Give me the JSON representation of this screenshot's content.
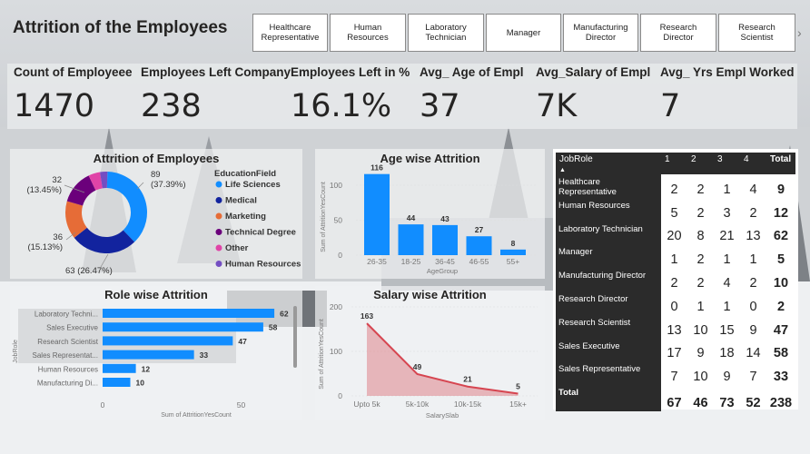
{
  "title": "Attrition of the Employees",
  "slicers": [
    "Healthcare Representative",
    "Human Resources",
    "Laboratory Technician",
    "Manager",
    "Manufacturing Director",
    "Research Director",
    "Research Scientist"
  ],
  "kpis": [
    {
      "label": "Count of Employeee",
      "value": "1470"
    },
    {
      "label": "Employees Left Company",
      "value": "238"
    },
    {
      "label": "Employees Left in %",
      "value": "16.1%"
    },
    {
      "label": "Avg_ Age of Empl",
      "value": "37"
    },
    {
      "label": "Avg_Salary of Empl",
      "value": "7K"
    },
    {
      "label": "Avg_ Yrs Empl Worked",
      "value": "7"
    }
  ],
  "chart_data": [
    {
      "type": "pie",
      "title": "Attrition of Employees",
      "legend_title": "EducationField",
      "legend_position": "right",
      "slices": [
        {
          "name": "Life Sciences",
          "value": 89,
          "label": "89\n(37.39%)",
          "color": "#118DFF"
        },
        {
          "name": "Medical",
          "value": 63,
          "label": "63 (26.47%)",
          "color": "#12239E"
        },
        {
          "name": "Marketing",
          "value": 36,
          "label": "36\n(15.13%)",
          "color": "#E66C37"
        },
        {
          "name": "Technical Degree",
          "value": 32,
          "label": "32\n(13.45%)",
          "color": "#6B007B"
        },
        {
          "name": "Other",
          "value": 11,
          "label": "",
          "color": "#E044A7"
        },
        {
          "name": "Human Resources",
          "value": 7,
          "label": "",
          "color": "#744EC2"
        }
      ]
    },
    {
      "type": "bar",
      "title": "Age wise Attrition",
      "xlabel": "AgeGroup",
      "ylabel": "Sum of AttritionYesCount",
      "categories": [
        "26-35",
        "18-25",
        "36-45",
        "46-55",
        "55+"
      ],
      "values": [
        116,
        44,
        43,
        27,
        8
      ],
      "ylim": [
        0,
        100
      ],
      "yticks": [
        0,
        50,
        100
      ],
      "color": "#118DFF"
    },
    {
      "type": "bar",
      "orientation": "horizontal",
      "title": "Role wise Attrition",
      "xlabel": "Sum of AttritionYesCount",
      "ylabel": "JobRole",
      "categories": [
        "Laboratory Techni...",
        "Sales Executive",
        "Research Scientist",
        "Sales Representat...",
        "Human Resources",
        "Manufacturing Di..."
      ],
      "values": [
        62,
        58,
        47,
        33,
        12,
        10
      ],
      "xticks": [
        0,
        50
      ],
      "color": "#118DFF"
    },
    {
      "type": "area",
      "title": "Salary wise Attrition",
      "xlabel": "SalarySlab",
      "ylabel": "Sum of AttritionYesCount",
      "categories": [
        "Upto 5k",
        "5k-10k",
        "10k-15k",
        "15k+"
      ],
      "values": [
        163,
        49,
        21,
        5
      ],
      "yticks": [
        0,
        100,
        200
      ],
      "color": "#D64550"
    },
    {
      "type": "table",
      "row_header": "JobRole",
      "columns": [
        "1",
        "2",
        "3",
        "4",
        "Total"
      ],
      "rows": [
        {
          "role": "Healthcare Representative",
          "values": [
            "2",
            "2",
            "1",
            "4",
            "9"
          ]
        },
        {
          "role": "Human Resources",
          "values": [
            "5",
            "2",
            "3",
            "2",
            "12"
          ]
        },
        {
          "role": "Laboratory Technician",
          "values": [
            "20",
            "8",
            "21",
            "13",
            "62"
          ]
        },
        {
          "role": "Manager",
          "values": [
            "1",
            "2",
            "1",
            "1",
            "5"
          ]
        },
        {
          "role": "Manufacturing Director",
          "values": [
            "2",
            "2",
            "4",
            "2",
            "10"
          ]
        },
        {
          "role": "Research Director",
          "values": [
            "0",
            "1",
            "1",
            "0",
            "2"
          ]
        },
        {
          "role": "Research Scientist",
          "values": [
            "13",
            "10",
            "15",
            "9",
            "47"
          ]
        },
        {
          "role": "Sales Executive",
          "values": [
            "17",
            "9",
            "18",
            "14",
            "58"
          ]
        },
        {
          "role": "Sales Representative",
          "values": [
            "7",
            "10",
            "9",
            "7",
            "33"
          ]
        }
      ],
      "total": {
        "role": "Total",
        "values": [
          "67",
          "46",
          "73",
          "52",
          "238"
        ]
      }
    }
  ]
}
